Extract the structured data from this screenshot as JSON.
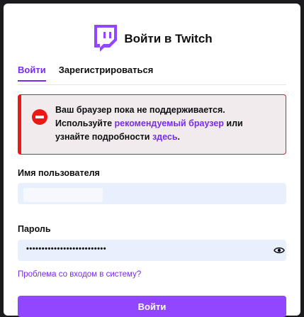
{
  "header": {
    "title": "Войти в Twitch",
    "logo": "twitch-glitch-logo",
    "brand_color": "#9147ff"
  },
  "tabs": [
    {
      "label": "Войти",
      "active": true
    },
    {
      "label": "Зарегистрироваться",
      "active": false
    }
  ],
  "alert": {
    "line1": "Ваш браузер пока не поддерживается.",
    "line2_prefix": "Используйте ",
    "recommended_link": "рекомендуемый браузер",
    "line2_suffix": " или",
    "line3_prefix": "узнайте подробности ",
    "here_link": "здесь",
    "line3_suffix": ".",
    "icon": "blocked-icon",
    "color": "#e91916"
  },
  "form": {
    "username_label": "Имя пользователя",
    "username_value": "",
    "password_label": "Пароль",
    "password_value": "••••••••••••••••••••••••••",
    "trouble_link": "Проблема со входом в систему?",
    "submit_label": "Войти"
  }
}
